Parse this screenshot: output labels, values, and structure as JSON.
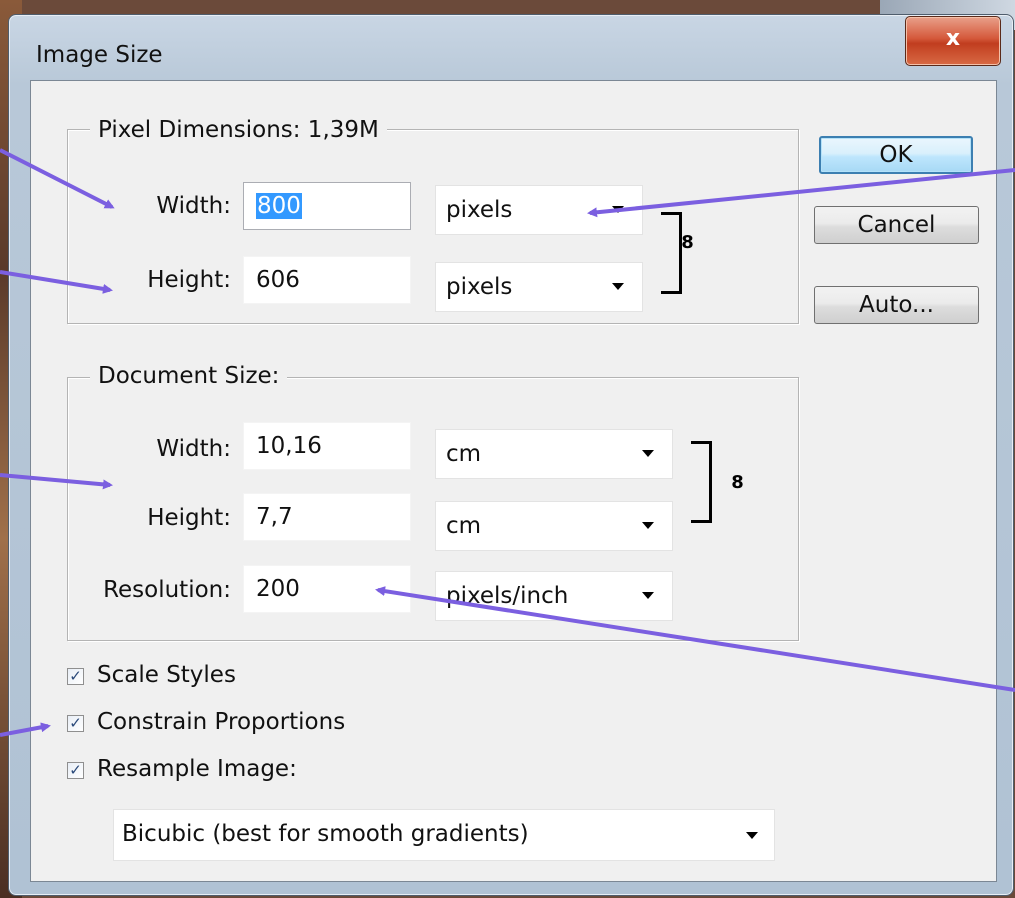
{
  "window": {
    "title": "Image Size",
    "close_label": "x"
  },
  "pixel_dimensions": {
    "legend": "Pixel Dimensions:  1,39M",
    "width": {
      "label": "Width:",
      "value": "800",
      "unit": "pixels"
    },
    "height": {
      "label": "Height:",
      "value": "606",
      "unit": "pixels"
    }
  },
  "document_size": {
    "legend": "Document Size:",
    "width": {
      "label": "Width:",
      "value": "10,16",
      "unit": "cm"
    },
    "height": {
      "label": "Height:",
      "value": "7,7",
      "unit": "cm"
    },
    "resolution": {
      "label": "Resolution:",
      "value": "200",
      "unit": "pixels/inch"
    }
  },
  "options": {
    "scale_styles": {
      "label": "Scale Styles",
      "checked": true
    },
    "constrain_proportions": {
      "label": "Constrain Proportions",
      "checked": true
    },
    "resample_image": {
      "label": "Resample Image:",
      "checked": true
    },
    "resample_method": "Bicubic (best for smooth gradients)"
  },
  "buttons": {
    "ok": "OK",
    "cancel": "Cancel",
    "auto": "Auto..."
  },
  "colors": {
    "annotation_arrow": "#7b5fe0",
    "selection": "#3399ff"
  },
  "icons": {
    "chain": "chain-link-icon",
    "dropdown": "chevron-down-icon",
    "check": "checkmark-icon"
  }
}
